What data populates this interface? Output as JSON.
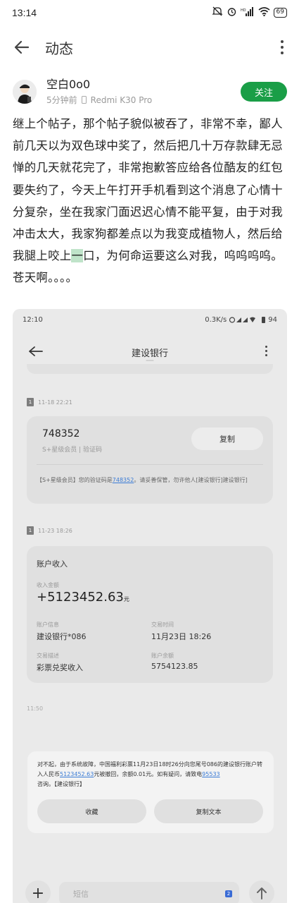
{
  "status_bar": {
    "time": "13:14",
    "battery": "69"
  },
  "app_bar": {
    "title": "动态"
  },
  "author": {
    "name": "空白0o0",
    "time_ago": "5分钟前",
    "device": "Redmi K30 Pro",
    "follow_label": "关注"
  },
  "post": {
    "text_before": "继上个帖子，那个帖子貌似被吞了，非常不幸，鄙人前几天以为双色球中奖了，然后把几十万存款肆无忌惮的几天就花完了，非常抱歉答应给各位酷友的红包要失约了，今天上午打开手机看到这个消息了心情十分复杂，坐在我家门面迟迟心情不能平复，由于对我冲击太大，我家狗都差点以为我变成植物人，然后给我腿上咬上",
    "highlight": "一",
    "text_after": "口，为何命运要这么对我，呜呜呜呜。苍天啊。。。。"
  },
  "screenshot": {
    "status_time": "12:10",
    "status_right": "0.3K/s",
    "status_battery": "94",
    "title": "建设银行",
    "msg1": {
      "timestamp": "11-18 22:21",
      "code": "748352",
      "code_sub": "S+星级会员 | 验证码",
      "copy_label": "复制",
      "text_before": "【S+星级会员】您的验证码是",
      "text_link": "748352",
      "text_after": "。请妥善保管，勿许他人[建设银行]建设银行]"
    },
    "msg2": {
      "timestamp": "11-23 18:26",
      "title": "账户收入",
      "amount_label": "收入金额",
      "amount": "+5123452.63",
      "amount_unit": "元",
      "account_label": "账户信息",
      "account_value": "建设银行*086",
      "time_label": "交易时间",
      "time_value": "11月23日  18:26",
      "desc_label": "交易描述",
      "desc_value": "彩票兑奖收入",
      "balance_label": "账户余额",
      "balance_value": "5754123.85"
    },
    "timestamp3": "11:50",
    "popup": {
      "text_before": "对不起，由于系统故障，中国福利彩票11月23日18时26分向您尾号086的建设银行账户转入人民币",
      "amount_link": "5123452.63",
      "text_middle": "元被撤回，余额0.01元。如有疑问，请致电",
      "phone_link": "95533",
      "text_after": "咨询。【建设银行】",
      "btn_save": "收藏",
      "btn_copy": "复制文本"
    },
    "compose_placeholder": "短信",
    "sim_label": "2"
  }
}
